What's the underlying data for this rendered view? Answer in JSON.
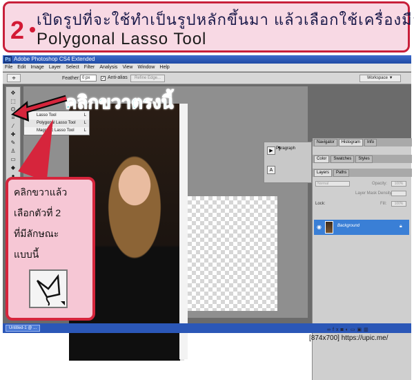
{
  "banner": {
    "step_number": "2",
    "line1": "เปิดรูปที่จะใช้ทำเป็นรูปหลักขึ้นมา แล้วเลือกใช้เครื่องมือ",
    "line2": "Polygonal Lasso Tool"
  },
  "window": {
    "title": "Adobe Photoshop CS4 Extended",
    "logo": "Ps"
  },
  "menu": [
    "File",
    "Edit",
    "Image",
    "Layer",
    "Select",
    "Filter",
    "Analysis",
    "View",
    "Window",
    "Help"
  ],
  "options": {
    "feather_label": "Feather:",
    "feather_value": "0 px",
    "antialias_label": "Anti-alias",
    "antialias_checked": true,
    "refine_label": "Refine Edge...",
    "workspace_label": "Workspace ▼"
  },
  "flyout": {
    "items": [
      {
        "label": "Lasso Tool",
        "key": "L"
      },
      {
        "label": "Polygonal Lasso Tool",
        "key": "L"
      },
      {
        "label": "Magnetic Lasso Tool",
        "key": "L"
      }
    ]
  },
  "mid_panel": {
    "paragraph_label": "Paragraph"
  },
  "panels": {
    "tabs_row1": [
      "Navigator",
      "Histogram",
      "Info"
    ],
    "tabs_row2": [
      "Color",
      "Swatches",
      "Styles"
    ],
    "tabs_row3": [
      "Layers",
      "Paths"
    ],
    "blend_mode": "Normal",
    "opacity_label": "Opacity:",
    "opacity_value": "100%",
    "mask_density_label": "Layer Mask Density:",
    "fill_label": "Fill:",
    "fill_value": "100%",
    "lock_label": "Lock:",
    "layer_name": "Background"
  },
  "annotation": {
    "heading": "คลิกขวาตรงนี้",
    "line1": "คลิกขวาแล้ว",
    "line2": "เลือกตัวที่ 2",
    "line3": "ที่มีลักษณะ",
    "line4": "แบบนี้"
  },
  "status": {
    "document": "Untitled-1 @ ..."
  },
  "watermark": "[874x700] https://upic.me/",
  "colors": {
    "accent_red": "#d6253c",
    "banner_pink": "#f8d9e4",
    "callout_pink": "#f6c7d5",
    "teal": "#1ec3c8",
    "layer_highlight": "#3a7fd6"
  }
}
